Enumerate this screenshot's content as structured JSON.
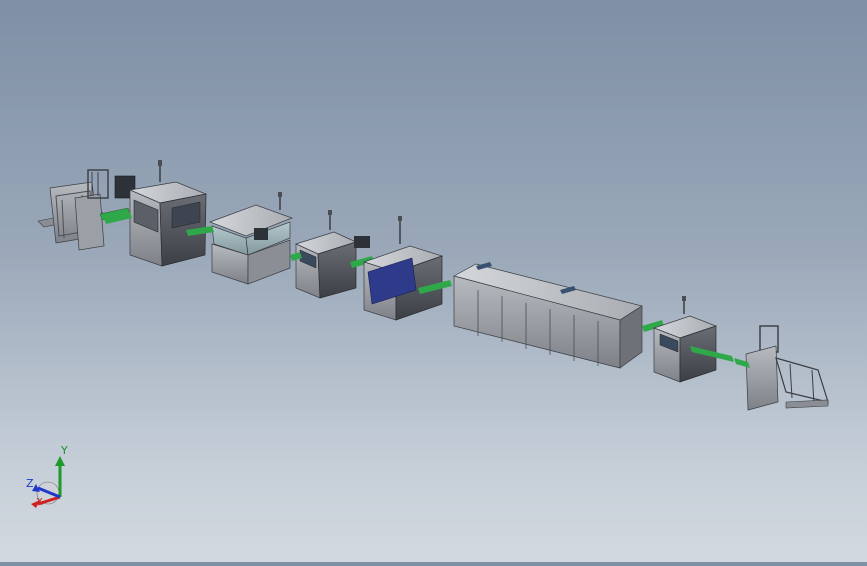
{
  "viewport": {
    "scene": "smt-production-line-assembly",
    "colors": {
      "background_top": "#7f8fa5",
      "background_bottom": "#d3d9e0",
      "machine_body": "#9ea2a8",
      "machine_dark": "#50545a",
      "conveyor_belt": "#2fa84a",
      "screen": "#3a4a5e"
    }
  },
  "triad": {
    "y_label": "Y",
    "z_label": "Z",
    "x_label": "X",
    "colors": {
      "x": "#d02020",
      "y": "#1e9a2a",
      "z": "#2038c8"
    }
  }
}
